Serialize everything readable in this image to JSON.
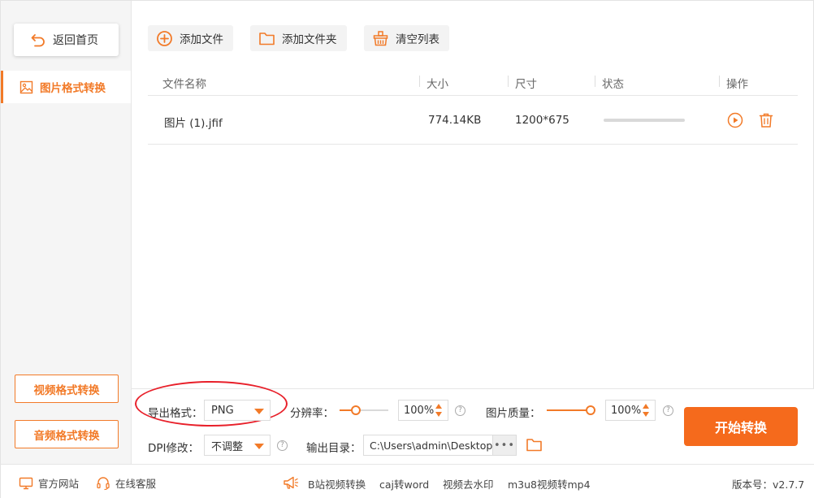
{
  "sidebar": {
    "home_label": "返回首页",
    "active_item_label": "图片格式转换",
    "video_label": "视频格式转换",
    "audio_label": "音频格式转换"
  },
  "toolbar": {
    "add_file_label": "添加文件",
    "add_folder_label": "添加文件夹",
    "clear_list_label": "清空列表"
  },
  "table": {
    "columns": [
      "文件名称",
      "大小",
      "尺寸",
      "状态",
      "操作"
    ],
    "rows": [
      {
        "name": "图片 (1).jfif",
        "size": "774.14KB",
        "dimensions": "1200*675",
        "progress": 0
      }
    ]
  },
  "settings": {
    "export_format_label": "导出格式：",
    "export_format_value": "PNG",
    "resolution_label": "分辨率：",
    "resolution_value": "100",
    "resolution_unit": "%",
    "resolution_level": 0.3,
    "quality_label": "图片质量：",
    "quality_value": "100",
    "quality_unit": "%",
    "quality_level": 1.0,
    "dpi_label": "DPI修改：",
    "dpi_value": "不调整",
    "output_dir_label": "输出目录：",
    "output_dir_value": "C:\\Users\\admin\\Desktop\\",
    "browse_dots": "•••",
    "help_glyph": "?",
    "start_label": "开始转换"
  },
  "footer": {
    "website_label": "官方网站",
    "support_label": "在线客服",
    "links": [
      "B站视频转换",
      "caj转word",
      "视频去水印",
      "m3u8视频转mp4"
    ],
    "version_label": "版本号：v2.7.7"
  },
  "colors": {
    "accent": "#f27a28",
    "start_button": "#f56a1c",
    "annotation": "#e8202a"
  }
}
